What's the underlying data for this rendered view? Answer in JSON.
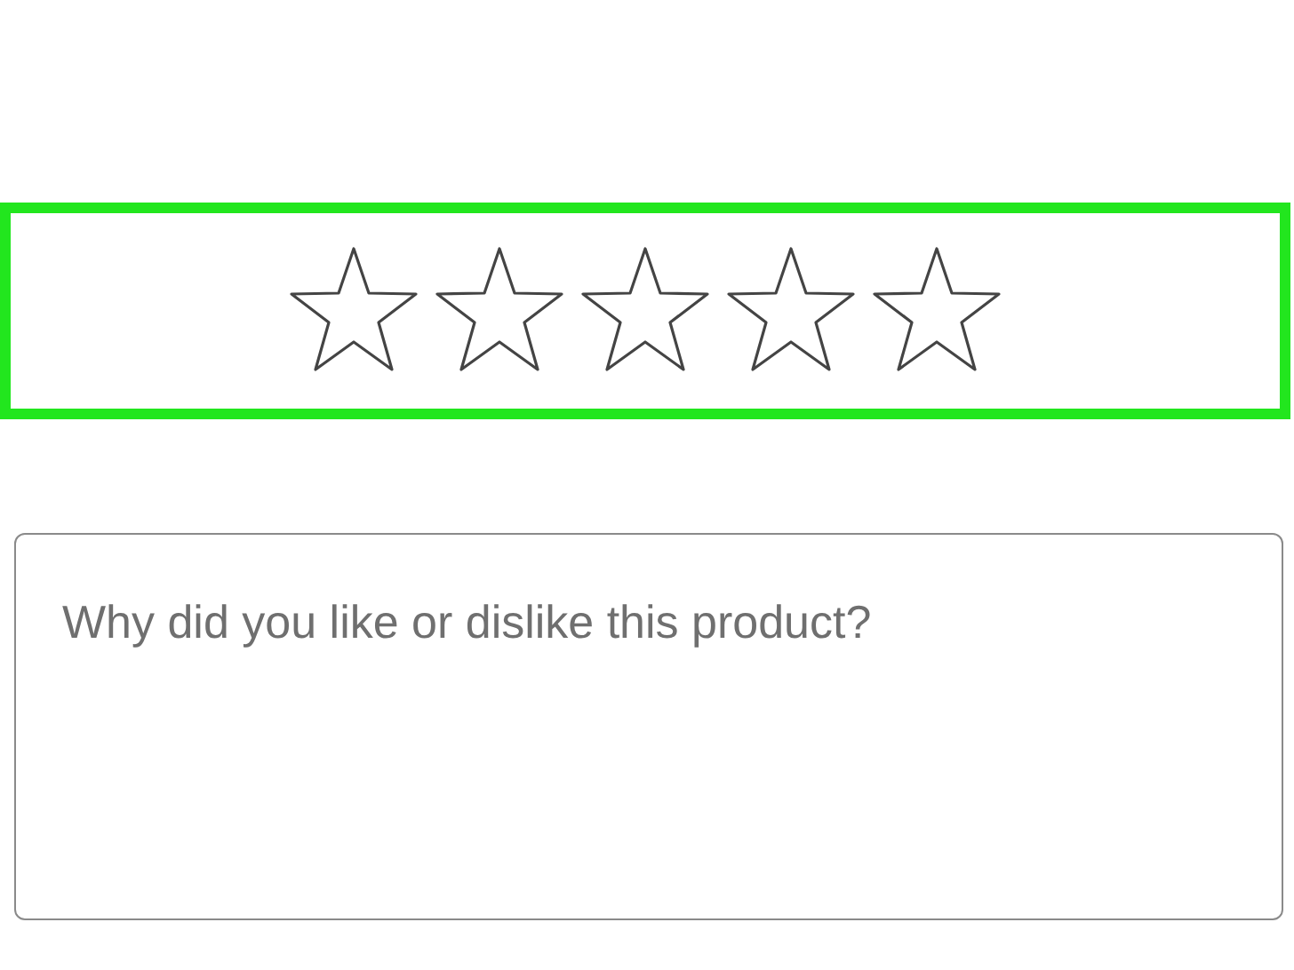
{
  "rating": {
    "stars": 0,
    "highlighted": true
  },
  "review": {
    "placeholder": "Why did you like or dislike this product?"
  }
}
